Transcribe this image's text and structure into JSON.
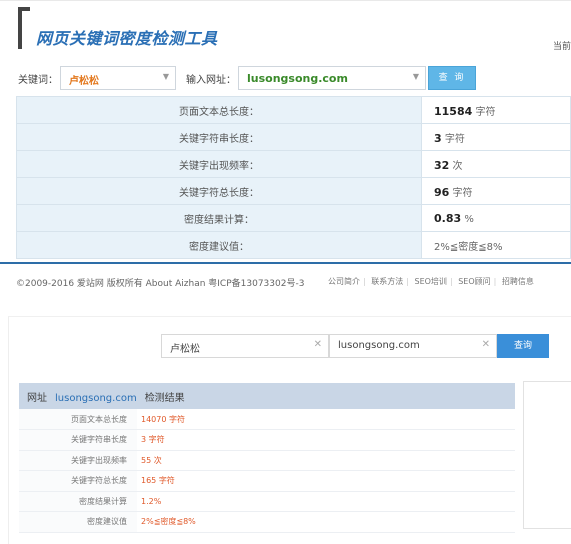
{
  "top": {
    "title": "网页关键词密度检测工具",
    "corner_text": "当前",
    "keyword_label": "关键词：",
    "keyword_value": "卢松松",
    "url_label": "输入网址：",
    "url_value": "lusongsong.com",
    "query_button": "查 询",
    "rows": [
      {
        "label": "页面文本总长度：",
        "value": "11584",
        "unit": "字符"
      },
      {
        "label": "关键字符串长度：",
        "value": "3",
        "unit": "字符"
      },
      {
        "label": "关键字出现频率：",
        "value": "32",
        "unit": "次"
      },
      {
        "label": "关键字符总长度：",
        "value": "96",
        "unit": "字符"
      },
      {
        "label": "密度结果计算：",
        "value": "0.83",
        "unit": "%"
      },
      {
        "label": "密度建议值：",
        "value": "",
        "unit": "2%≦密度≦8%"
      }
    ],
    "footer_copyright": "©2009-2016 爱站网 版权所有 About Aizhan   粤ICP备13073302号-3",
    "footer_links": [
      "公司简介",
      "联系方法",
      "SEO培训",
      "SEO顾问",
      "招聘信息"
    ]
  },
  "bottom": {
    "keyword_value": "卢松松",
    "url_value": "lusongsong.com",
    "query_button": "查询",
    "header_prefix": "网址",
    "header_site": "lusongsong.com",
    "header_suffix": "检测结果",
    "rows": [
      {
        "label": "页面文本总长度",
        "value": "14070 字符"
      },
      {
        "label": "关键字符串长度",
        "value": "3 字符"
      },
      {
        "label": "关键字出现频率",
        "value": "55 次"
      },
      {
        "label": "关键字符总长度",
        "value": "165 字符"
      },
      {
        "label": "密度结果计算",
        "value": "1.2%"
      },
      {
        "label": "密度建议值",
        "value": "2%≦密度≦8%"
      }
    ]
  }
}
